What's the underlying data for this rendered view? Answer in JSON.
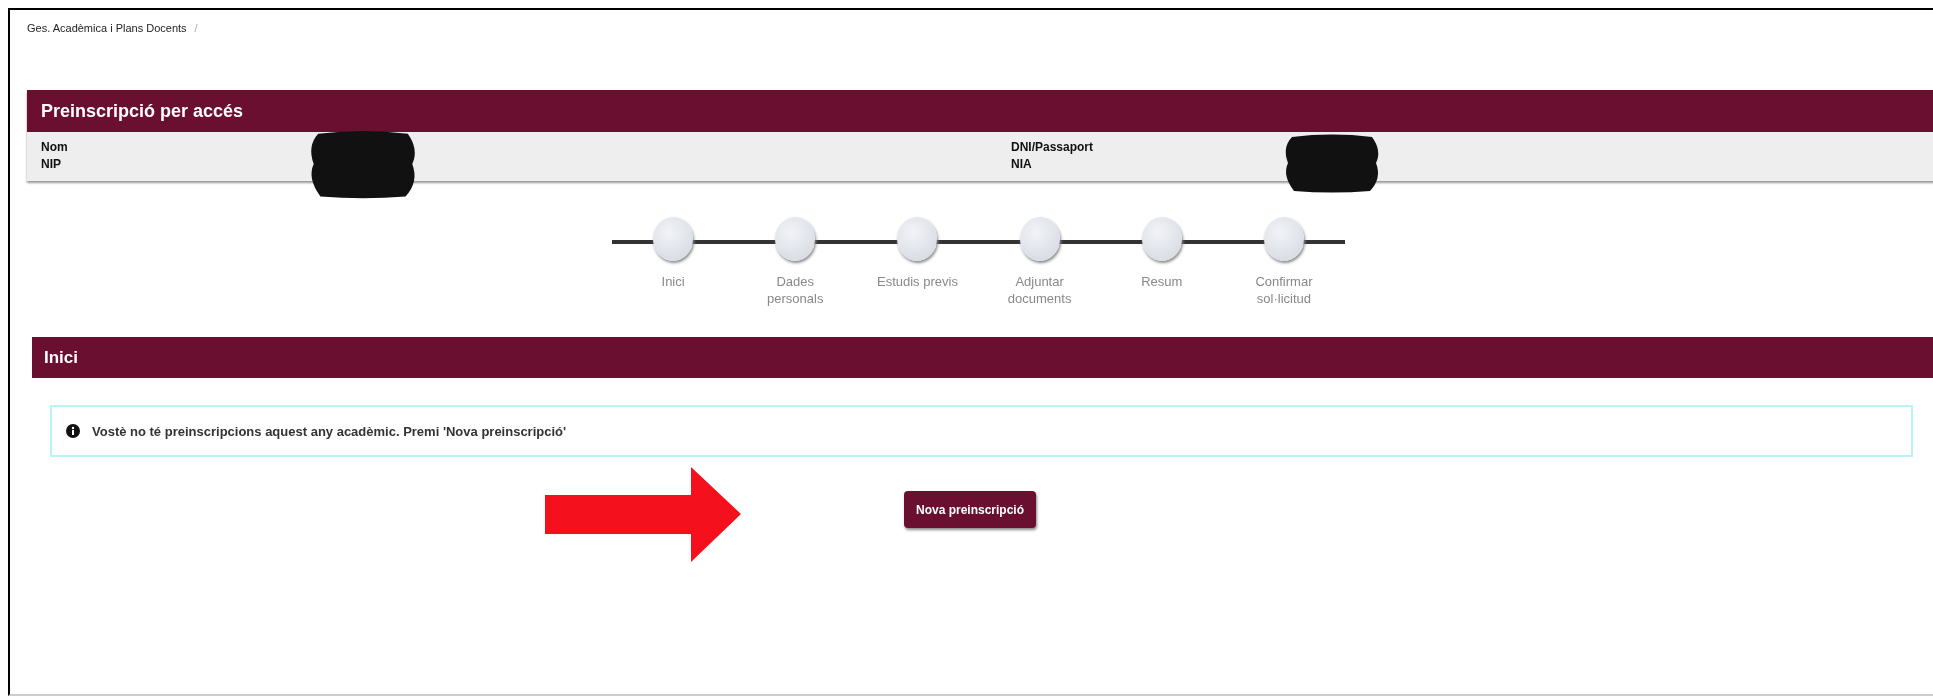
{
  "breadcrumb": {
    "items": [
      "Ges. Acadèmica i Plans Docents"
    ],
    "separator": "/"
  },
  "applicant_panel": {
    "title": "Preinscripció per accés",
    "fields_left": [
      "Nom",
      "NIP"
    ],
    "fields_right": [
      "DNI/Passaport",
      "NIA"
    ]
  },
  "steps": [
    {
      "label": "Inici"
    },
    {
      "label": "Dades\npersonals"
    },
    {
      "label": "Estudis previs"
    },
    {
      "label": "Adjuntar\ndocuments"
    },
    {
      "label": "Resum"
    },
    {
      "label": "Confirmar\nsol·licitud"
    }
  ],
  "section": {
    "title": "Inici"
  },
  "info_message": "Vostè no té preinscripcions aquest any acadèmic. Premi 'Nova preinscripció'",
  "primary_button": "Nova preinscripció"
}
